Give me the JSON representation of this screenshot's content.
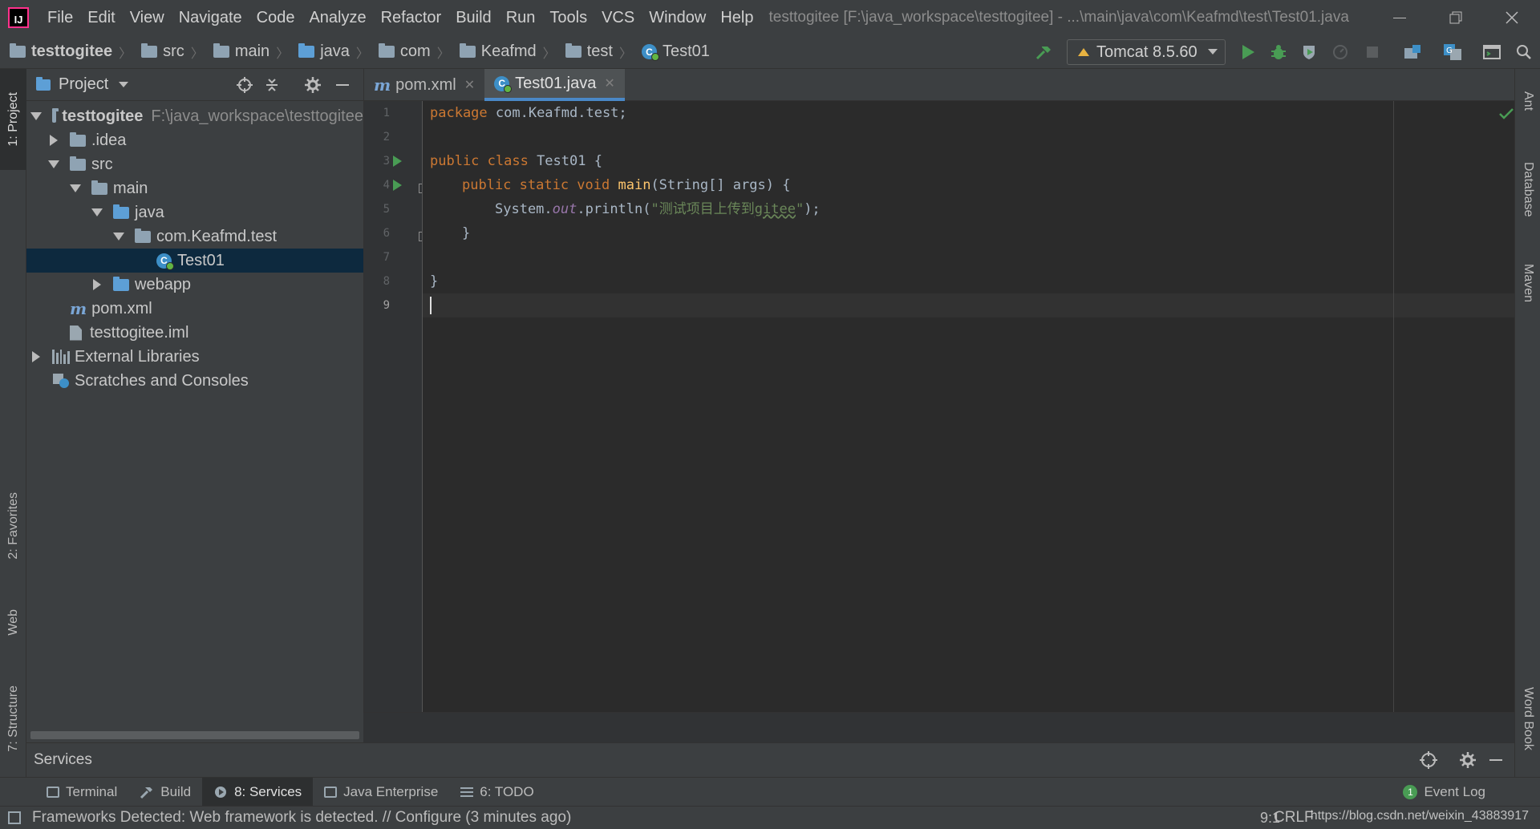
{
  "app": {
    "logo_text": "IJ",
    "window_title": "testtogitee [F:\\java_workspace\\testtogitee] - ...\\main\\java\\com\\Keafmd\\test\\Test01.java"
  },
  "menu": [
    "File",
    "Edit",
    "View",
    "Navigate",
    "Code",
    "Analyze",
    "Refactor",
    "Build",
    "Run",
    "Tools",
    "VCS",
    "Window",
    "Help"
  ],
  "breadcrumbs": [
    "testtogitee",
    "src",
    "main",
    "java",
    "com",
    "Keafmd",
    "test",
    "Test01"
  ],
  "run_config": {
    "label": "Tomcat 8.5.60"
  },
  "left_strip": {
    "project": "1: Project",
    "favorites": "2: Favorites",
    "web": "Web",
    "structure": "7: Structure"
  },
  "right_strip": {
    "ant": "Ant",
    "database": "Database",
    "maven": "Maven",
    "word_book": "Word Book"
  },
  "project_panel": {
    "title": "Project",
    "tree": [
      {
        "label": "testtogitee",
        "hint": "F:\\java_workspace\\testtogitee"
      },
      {
        "label": ".idea"
      },
      {
        "label": "src"
      },
      {
        "label": "main"
      },
      {
        "label": "java"
      },
      {
        "label": "com.Keafmd.test"
      },
      {
        "label": "Test01"
      },
      {
        "label": "webapp"
      },
      {
        "label": "pom.xml"
      },
      {
        "label": "testtogitee.iml"
      },
      {
        "label": "External Libraries"
      },
      {
        "label": "Scratches and Consoles"
      }
    ]
  },
  "editor": {
    "tabs": [
      {
        "label": "pom.xml",
        "icon": "m"
      },
      {
        "label": "Test01.java",
        "icon": "C"
      }
    ],
    "line_numbers": [
      "1",
      "2",
      "3",
      "4",
      "5",
      "6",
      "7",
      "8",
      "9"
    ],
    "code": {
      "l1_kw": "package",
      "l1_rest": " com.Keafmd.test;",
      "l3_kw": "public class",
      "l3_rest": " Test01 {",
      "l4_kw": "public static void",
      "l4_fn": "main",
      "l4_rest": "(String[] args) {",
      "l5_a": "System.",
      "l5_fld": "out",
      "l5_b": ".println(",
      "l5_str1": "\"测试项目上传到",
      "l5_str2": "gitee",
      "l5_str3": "\"",
      "l5_end": ");",
      "l6": "}",
      "l8": "}"
    },
    "cursor_position": "9:1"
  },
  "services": {
    "title": "Services"
  },
  "bottom_tabs": [
    {
      "label": "Terminal"
    },
    {
      "label": "Build"
    },
    {
      "label": "8: Services"
    },
    {
      "label": "Java Enterprise"
    },
    {
      "label": "6: TODO"
    }
  ],
  "event_log": {
    "label": "Event Log",
    "count": "1"
  },
  "status": {
    "message": "Frameworks Detected: Web framework is detected. // Configure (3 minutes ago)",
    "position": "9:1",
    "line_sep": "CRLF",
    "watermark": "https://blog.csdn.net/weixin_43883917"
  },
  "colors": {
    "accent": "#4a88c7",
    "run_green": "#499c54",
    "selection": "#0d293e"
  }
}
